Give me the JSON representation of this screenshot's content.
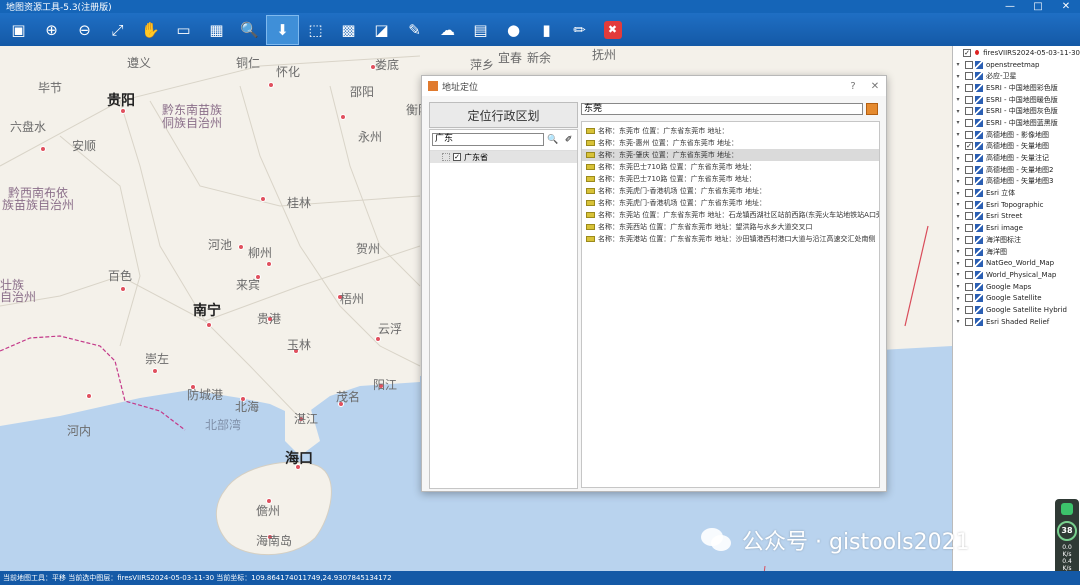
{
  "app": {
    "title": "地图资源工具-5.3(注册版)",
    "window_buttons": [
      "—",
      "□",
      "✕"
    ]
  },
  "toolbar": [
    {
      "name": "save-icon",
      "glyph": "▣"
    },
    {
      "name": "zoom-in-icon",
      "glyph": "⊕"
    },
    {
      "name": "zoom-out-icon",
      "glyph": "⊖"
    },
    {
      "name": "full-extent-icon",
      "glyph": "⤢"
    },
    {
      "name": "pan-icon",
      "glyph": "✋"
    },
    {
      "name": "measure-distance-icon",
      "glyph": "▭"
    },
    {
      "name": "measure-area-icon",
      "glyph": "▦"
    },
    {
      "name": "search-icon",
      "glyph": "🔍"
    },
    {
      "name": "locate-icon",
      "glyph": "⬇"
    },
    {
      "name": "select-box-icon",
      "glyph": "⬚"
    },
    {
      "name": "grid-icon",
      "glyph": "▩"
    },
    {
      "name": "clear-icon",
      "glyph": "◪"
    },
    {
      "name": "tools-icon",
      "glyph": "✎"
    },
    {
      "name": "cloud-icon",
      "glyph": "☁"
    },
    {
      "name": "layers-icon",
      "glyph": "▤"
    },
    {
      "name": "user-icon",
      "glyph": "●"
    },
    {
      "name": "book-icon",
      "glyph": "▮"
    },
    {
      "name": "edit-icon",
      "glyph": "✏"
    },
    {
      "name": "exit-icon",
      "glyph": "✖"
    }
  ],
  "map": {
    "labels": [
      {
        "text": "遵义",
        "kind": "normal"
      },
      {
        "text": "铜仁",
        "kind": "normal"
      },
      {
        "text": "怀化",
        "kind": "normal"
      },
      {
        "text": "娄底",
        "kind": "normal"
      },
      {
        "text": "萍乡",
        "kind": "normal"
      },
      {
        "text": "宜春",
        "kind": "normal"
      },
      {
        "text": "新余",
        "kind": "normal"
      },
      {
        "text": "毕节",
        "kind": "normal"
      },
      {
        "text": "贵阳",
        "kind": "city"
      },
      {
        "text": "黔东南苗族",
        "kind": "prov"
      },
      {
        "text": "侗族自治州",
        "kind": "prov"
      },
      {
        "text": "邵阳",
        "kind": "normal"
      },
      {
        "text": "衡阳",
        "kind": "normal"
      },
      {
        "text": "六盘水",
        "kind": "normal"
      },
      {
        "text": "安顺",
        "kind": "normal"
      },
      {
        "text": "永州",
        "kind": "normal"
      },
      {
        "text": "黔西南布依",
        "kind": "prov"
      },
      {
        "text": "族苗族自治州",
        "kind": "prov"
      },
      {
        "text": "桂林",
        "kind": "normal"
      },
      {
        "text": "河池",
        "kind": "normal"
      },
      {
        "text": "柳州",
        "kind": "normal"
      },
      {
        "text": "贺州",
        "kind": "normal"
      },
      {
        "text": "来宾",
        "kind": "normal"
      },
      {
        "text": "百色",
        "kind": "normal"
      },
      {
        "text": "南宁",
        "kind": "city"
      },
      {
        "text": "贵港",
        "kind": "normal"
      },
      {
        "text": "梧州",
        "kind": "normal"
      },
      {
        "text": "玉林",
        "kind": "normal"
      },
      {
        "text": "云浮",
        "kind": "normal"
      },
      {
        "text": "崇左",
        "kind": "normal"
      },
      {
        "text": "防城港",
        "kind": "normal"
      },
      {
        "text": "北海",
        "kind": "normal"
      },
      {
        "text": "茂名",
        "kind": "normal"
      },
      {
        "text": "阳江",
        "kind": "normal"
      },
      {
        "text": "北部湾",
        "kind": "sea"
      },
      {
        "text": "湛江",
        "kind": "normal"
      },
      {
        "text": "河内",
        "kind": "normal"
      },
      {
        "text": "海口",
        "kind": "city"
      },
      {
        "text": "儋州",
        "kind": "normal"
      },
      {
        "text": "海南岛",
        "kind": "normal"
      },
      {
        "text": "壮族",
        "kind": "prov"
      },
      {
        "text": "自治州",
        "kind": "prov"
      },
      {
        "text": "抚州",
        "kind": "normal"
      }
    ]
  },
  "dialog": {
    "title": "地址定位",
    "help_button": "?",
    "close_button": "✕",
    "region_button": "定位行政区划",
    "region_search_value": "广东",
    "tree": [
      {
        "label": "广东省",
        "checked": true
      }
    ],
    "result_search_value": "东莞",
    "results": [
      "名称：东莞市  位置：广东省东莞市  地址：",
      "名称：东莞-惠州  位置：广东省东莞市  地址：",
      "名称：东莞-肇庆  位置：广东省东莞市  地址：",
      "名称：东莞巴士710路  位置：广东省东莞市  地址：",
      "名称：东莞巴士710路  位置：广东省东莞市  地址：",
      "名称：东莞虎门-香港机场  位置：广东省东莞市  地址：",
      "名称：东莞虎门-香港机场  位置：广东省东莞市  地址：",
      "名称：东莞站  位置：广东省东莞市  地址：石龙镇西湖社区站前西路(东莞火车站地铁站A口旁)",
      "名称：东莞西站  位置：广东省东莞市  地址：望洪路与水乡大道交叉口",
      "名称：东莞港站  位置：广东省东莞市  地址：沙田镇港西村港口大道与沿江高速交汇处南侧"
    ],
    "selected_result_index": 2
  },
  "layers": [
    {
      "label": "firesVIIRS2024-05-03-11-30",
      "checked": true,
      "icon": "red"
    },
    {
      "label": "openstreetmap",
      "checked": false
    },
    {
      "label": "必应-卫星",
      "checked": false
    },
    {
      "label": "ESRI - 中国地图彩色版",
      "checked": false
    },
    {
      "label": "ESRI - 中国地图暖色版",
      "checked": false
    },
    {
      "label": "ESRI - 中国地图灰色版",
      "checked": false
    },
    {
      "label": "ESRI - 中国地图蓝黑版",
      "checked": false
    },
    {
      "label": "高德地图 - 影像地图",
      "checked": false
    },
    {
      "label": "高德地图 - 矢量地图",
      "checked": true
    },
    {
      "label": "高德地图 - 矢量注记",
      "checked": false
    },
    {
      "label": "高德地图 - 矢量地图2",
      "checked": false
    },
    {
      "label": "高德地图 - 矢量地图3",
      "checked": false
    },
    {
      "label": "Esri 立体",
      "checked": false
    },
    {
      "label": "Esri Topographic",
      "checked": false
    },
    {
      "label": "Esri Street",
      "checked": false
    },
    {
      "label": "Esri image",
      "checked": false
    },
    {
      "label": "海洋图标注",
      "checked": false
    },
    {
      "label": "海洋图",
      "checked": false
    },
    {
      "label": "NatGeo_World_Map",
      "checked": false
    },
    {
      "label": "World_Physical_Map",
      "checked": false
    },
    {
      "label": "Google Maps",
      "checked": false
    },
    {
      "label": "Google Satellite",
      "checked": false
    },
    {
      "label": "Google Satellite Hybrid",
      "checked": false
    },
    {
      "label": "Esri Shaded Relief",
      "checked": false
    }
  ],
  "status_bar": {
    "text": "当前地图工具：平移  当前选中图层：firesVIIRS2024-05-03-11-30  当前坐标：109.864174011749,24.9307845134172"
  },
  "watermark": {
    "text": "公众号 · gistools2021"
  },
  "perf_widget": {
    "percent": "38",
    "up": "0.0",
    "down": "0.4",
    "unit": "K/s"
  },
  "colors": {
    "title_bar": "#1565b8",
    "toolbar": "#1459a6",
    "map_bg": "#f4f1ea",
    "sea": "#b9d3ee",
    "border": "#c43a8a"
  }
}
